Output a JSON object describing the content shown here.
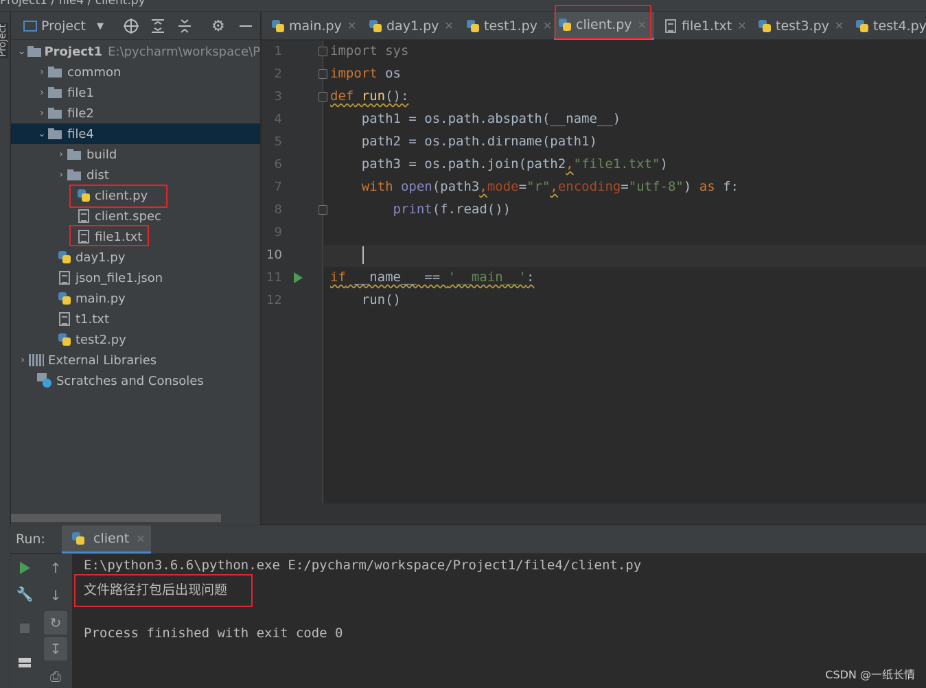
{
  "crumb": {
    "text": "Project1 / file4 / client.py"
  },
  "left_strip": {
    "label": "Project"
  },
  "project_panel": {
    "view_selector": "Project",
    "tree": [
      {
        "label": "Project1",
        "hint": "E:\\pycharm\\workspace\\P",
        "type": "root",
        "expanded": true
      },
      {
        "label": "common",
        "type": "folder"
      },
      {
        "label": "file1",
        "type": "folder"
      },
      {
        "label": "file2",
        "type": "folder"
      },
      {
        "label": "file4",
        "type": "folder",
        "expanded": true,
        "selected": true
      },
      {
        "label": "build",
        "type": "folder"
      },
      {
        "label": "dist",
        "type": "folder"
      },
      {
        "label": "client.py",
        "type": "python",
        "highlighted": true
      },
      {
        "label": "client.spec",
        "type": "text"
      },
      {
        "label": "file1.txt",
        "type": "text",
        "highlighted": true
      },
      {
        "label": "day1.py",
        "type": "python"
      },
      {
        "label": "json_file1.json",
        "type": "json"
      },
      {
        "label": "main.py",
        "type": "python"
      },
      {
        "label": "t1.txt",
        "type": "text"
      },
      {
        "label": "test2.py",
        "type": "python"
      },
      {
        "label": "External Libraries",
        "type": "library"
      },
      {
        "label": "Scratches and Consoles",
        "type": "scratch"
      }
    ]
  },
  "tabs": [
    {
      "label": "main.py",
      "icon": "python-file-icon"
    },
    {
      "label": "day1.py",
      "icon": "python-file-icon"
    },
    {
      "label": "test1.py",
      "icon": "python-file-icon"
    },
    {
      "label": "client.py",
      "icon": "python-file-icon",
      "active": true,
      "highlighted": true
    },
    {
      "label": "file1.txt",
      "icon": "text-file-icon"
    },
    {
      "label": "test3.py",
      "icon": "python-file-icon"
    },
    {
      "label": "test4.py",
      "icon": "python-file-icon"
    }
  ],
  "editor": {
    "line_numbers": [
      "1",
      "2",
      "3",
      "4",
      "5",
      "6",
      "7",
      "8",
      "9",
      "10",
      "11",
      "12"
    ],
    "current_line": "10",
    "code": {
      "l1_kw": "import",
      "l1_mod": " sys",
      "l2_kw": "import",
      "l2_mod": " os",
      "l3_kw": "def",
      "l3_fn": " run",
      "l3_rest": "():",
      "l4": "    path1 = os.path.abspath(__name__)",
      "l5": "    path2 = os.path.dirname(path1)",
      "l6_a": "    path3 = os.path.join(path2",
      "l6_b": ",",
      "l6_str": "\"file1.txt\"",
      "l6_c": ")",
      "l7_kw": "    with",
      "l7_bi": " open",
      "l7_a": "(path3",
      "l7_comma1": ",",
      "l7_p1": "mode",
      "l7_eq1": "=",
      "l7_s1": "\"r\"",
      "l7_comma2": ",",
      "l7_p2": "encoding",
      "l7_eq2": "=",
      "l7_s2": "\"utf-8\"",
      "l7_b": ") ",
      "l7_as": "as",
      "l7_c": " f:",
      "l8_pad": "        ",
      "l8_bi": "print",
      "l8_rest": "(f.read())",
      "l11_kw": "if",
      "l11_a": " __name__ == ",
      "l11_str": "'__main__'",
      "l11_b": ":",
      "l12": "    run()"
    }
  },
  "run_panel": {
    "label": "Run:",
    "tab_label": "client",
    "console": {
      "command": "E:\\python3.6.6\\python.exe E:/pycharm/workspace/Project1/file4/client.py",
      "output": "文件路径打包后出现问题",
      "exit": "Process finished with exit code 0"
    }
  },
  "watermark": "CSDN @一纸长情",
  "colors": {
    "highlight_box": "#e0262b",
    "selection": "#0d293e",
    "accent": "#4a88c7"
  }
}
